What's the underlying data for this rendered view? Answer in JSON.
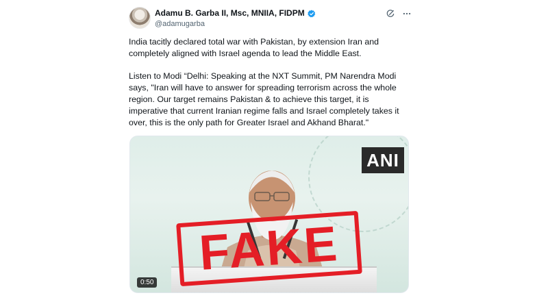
{
  "author": {
    "display_name": "Adamu B. Garba II, Msc, MNIIA, FIDPM",
    "handle": "@adamugarba",
    "avatar_icon": "user-avatar",
    "verified_icon": "verified-badge-icon",
    "verified_color": "#1d9bf0"
  },
  "actions": {
    "grok_icon": "grok-icon",
    "more_icon": "more-options-icon"
  },
  "tweet": {
    "paragraph_1": "India tacitly declared total war with Pakistan, by extension Iran and\ncompletely aligned with Israel agenda to lead the Middle East.",
    "paragraph_2": "Listen to Modi “Delhi: Speaking at the NXT Summit, PM Narendra Modi\nsays, \"Iran will have to answer for spreading terrorism across the whole\nregion. Our target remains Pakistan & to achieve this target, it is\nimperative that current Iranian regime falls and Israel completely takes it\nover, this is the only path for Greater Israel and Akhand Bharat.\""
  },
  "media": {
    "watermark": "ANI",
    "stamp": "FAKE",
    "stamp_color": "#e41e26",
    "duration": "0:50"
  }
}
